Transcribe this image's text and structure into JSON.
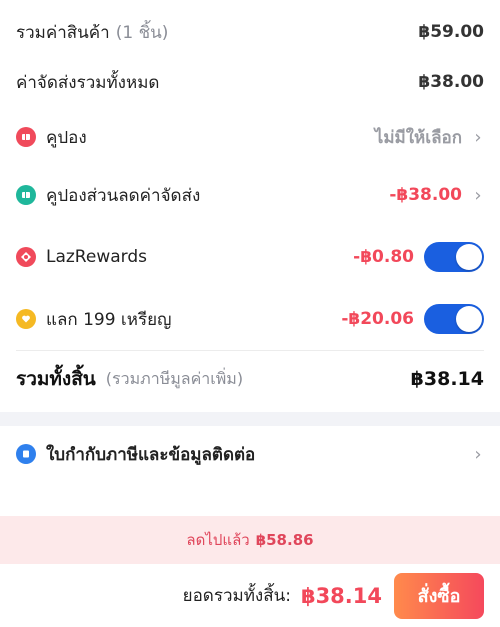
{
  "summary": {
    "subtotal_label": "รวมค่าสินค้า",
    "subtotal_qty": "(1 ชิ้น)",
    "subtotal_value": "฿59.00",
    "shipping_label": "ค่าจัดส่งรวมทั้งหมด",
    "shipping_value": "฿38.00",
    "voucher_label": "คูปอง",
    "voucher_value": "ไม่มีให้เลือก",
    "shipping_voucher_label": "คูปองส่วนลดค่าจัดส่ง",
    "shipping_voucher_value": "-฿38.00",
    "lazrewards_label": "LazRewards",
    "lazrewards_value": "-฿0.80",
    "lazrewards_enabled": true,
    "coins_label": "แลก 199 เหรียญ",
    "coins_value": "-฿20.06",
    "coins_enabled": true,
    "total_label": "รวมทั้งสิ้น",
    "total_sub": "(รวมภาษีมูลค่าเพิ่ม)",
    "total_value": "฿38.14"
  },
  "invoice": {
    "label": "ใบกำกับภาษีและข้อมูลติดต่อ"
  },
  "savings": {
    "label": "ลดไปแล้ว",
    "value": "฿58.86"
  },
  "footer": {
    "grand_total_label": "ยอดรวมทั้งสิ้น:",
    "grand_total_value": "฿38.14",
    "order_button": "สั่งซื้อ"
  },
  "icons": {
    "voucher": "voucher-icon",
    "shipping_voucher": "shipping-voucher-icon",
    "lazrewards": "lazrewards-icon",
    "coins": "coin-icon",
    "invoice": "invoice-icon",
    "chevron": "chevron-right-icon"
  },
  "colors": {
    "accent_red": "#f2485a",
    "toggle_blue": "#1a5fe0",
    "voucher_icon": "#f04a5b",
    "shipping_icon": "#1fb79b",
    "coin_icon": "#f5b923",
    "invoice_icon": "#2f80ed"
  }
}
